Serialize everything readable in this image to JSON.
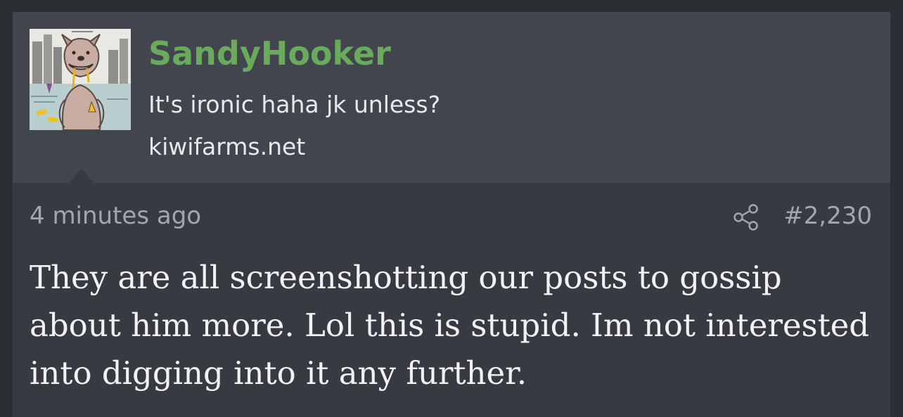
{
  "post": {
    "username": "SandyHooker",
    "user_title": "It's ironic haha jk unless?",
    "user_site": "kiwifarms.net",
    "avatar_icon": "pitbull-avatar",
    "timestamp": "4 minutes ago",
    "share_icon": "share-icon",
    "post_number": "#2,230",
    "message": "They are all screenshotting our posts to gossip about him more. Lol this is stupid. Im not interested into digging into it any further."
  },
  "colors": {
    "background": "#2b2e33",
    "header_bg": "#42454d",
    "body_bg": "#373a41",
    "username": "#6aaa5c",
    "meta_text": "#a3a6ad",
    "message_text": "#f2f2f3"
  }
}
